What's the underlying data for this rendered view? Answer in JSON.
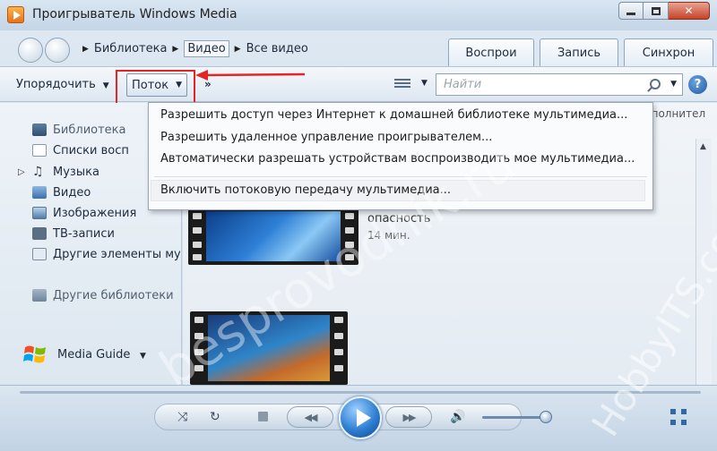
{
  "window": {
    "title": "Проигрыватель Windows Media",
    "min_icon": "minimize-icon",
    "max_icon": "maximize-icon",
    "close_label": "✕"
  },
  "nav": {
    "breadcrumb": [
      "Библиотека",
      "Видео",
      "Все видео"
    ],
    "tabs": [
      "Воспрои",
      "Запись",
      "Синхрон"
    ]
  },
  "toolbar": {
    "organize": "Упорядочить",
    "stream": "Поток",
    "more": "»",
    "search_placeholder": "Найти",
    "help": "?"
  },
  "sidebar": {
    "items": [
      {
        "label": "Библиотека",
        "icon": "library-icon"
      },
      {
        "label": "Списки восп",
        "icon": "playlists-icon"
      },
      {
        "label": "Музыка",
        "icon": "music-icon"
      },
      {
        "label": "Видео",
        "icon": "video-icon"
      },
      {
        "label": "Изображения",
        "icon": "pictures-icon"
      },
      {
        "label": "ТВ-записи",
        "icon": "recorded-tv-icon"
      },
      {
        "label": "Другие элементы мул",
        "icon": "other-media-icon"
      }
    ],
    "other_libraries": "Другие библиотеки",
    "media_guide": "Media Guide"
  },
  "content": {
    "column_header": "сполнител",
    "item_title": "опасность",
    "item_duration": "14 мин."
  },
  "stream_menu": {
    "items": [
      "Разрешить доступ через Интернет к домашней библиотеке мультимедиа...",
      "Разрешить удаленное управление проигрывателем...",
      "Автоматически разрешать устройствам воспроизводить мое мультимедиа...",
      "Включить потоковую передачу мультимедиа..."
    ]
  },
  "player": {
    "shuffle": "⤨",
    "repeat": "↻",
    "prev": "◀◀",
    "next": "▶▶",
    "volume_icon": "🔊"
  },
  "watermarks": {
    "left": "besprovodnik.ru",
    "right": "HobbyITS.com"
  },
  "colors": {
    "highlight_box": "#e42525",
    "arrow": "#e42525"
  }
}
